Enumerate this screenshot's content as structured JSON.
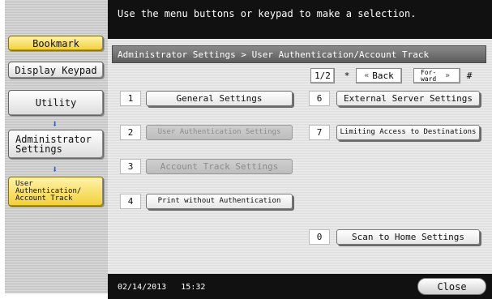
{
  "message": "Use the menu buttons or keypad to make a selection.",
  "sidebar": {
    "bookmark": "Bookmark",
    "display_keypad": "Display Keypad",
    "utility": "Utility",
    "administrator_settings": "Administrator Settings",
    "current": "User Authentication/ Account Track"
  },
  "panel": {
    "breadcrumb": "Administrator Settings > User Authentication/Account Track",
    "page": "1/2",
    "star": "*",
    "back": "Back",
    "forward": "For- ward",
    "hash": "#",
    "items": [
      {
        "num": "1",
        "label": "General Settings",
        "disabled": false
      },
      {
        "num": "2",
        "label": "User Authentication Settings",
        "disabled": true
      },
      {
        "num": "3",
        "label": "Account Track Settings",
        "disabled": true
      },
      {
        "num": "4",
        "label": "Print without Authentication",
        "disabled": false
      },
      {
        "num": "6",
        "label": "External Server Settings",
        "disabled": false
      },
      {
        "num": "7",
        "label": "Limiting Access to Destinations",
        "disabled": false
      },
      {
        "num": "0",
        "label": "Scan to Home Settings",
        "disabled": false
      }
    ]
  },
  "status": {
    "date": "02/14/2013",
    "time": "15:32",
    "close": "Close"
  }
}
